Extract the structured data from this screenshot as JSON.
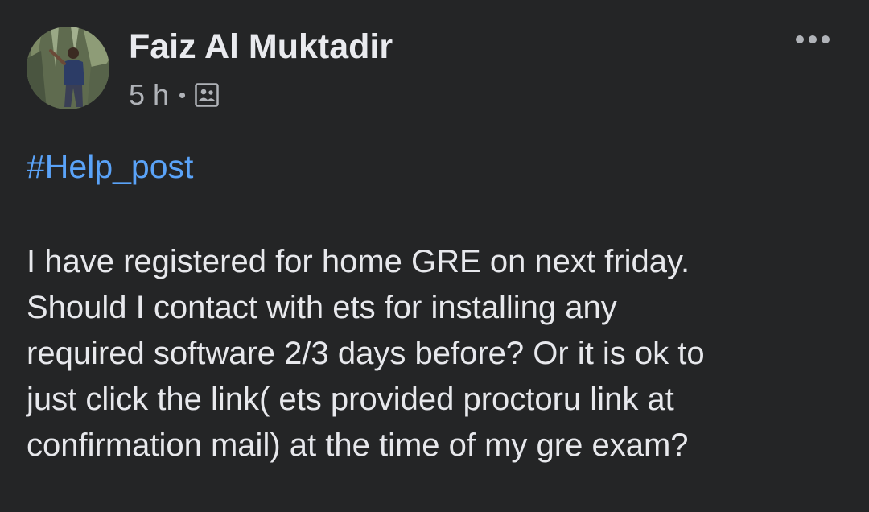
{
  "post": {
    "author_name": "Faiz Al Muktadir",
    "timestamp": "5 h",
    "separator": "•",
    "audience_icon": "group-audience-icon",
    "more_icon": "more-options-icon",
    "hashtag": "#Help_post",
    "body_lines": [
      "I have registered for home GRE on next friday.",
      "Should I contact with ets for installing any",
      "required software 2/3 days before? Or it is ok to",
      "just click the link( ets provided proctoru link at",
      "confirmation mail) at the time of my gre exam?"
    ]
  },
  "colors": {
    "background": "#242526",
    "primary_text": "#e4e6eb",
    "secondary_text": "#b0b3b8",
    "hashtag_link": "#5aa3f8"
  }
}
